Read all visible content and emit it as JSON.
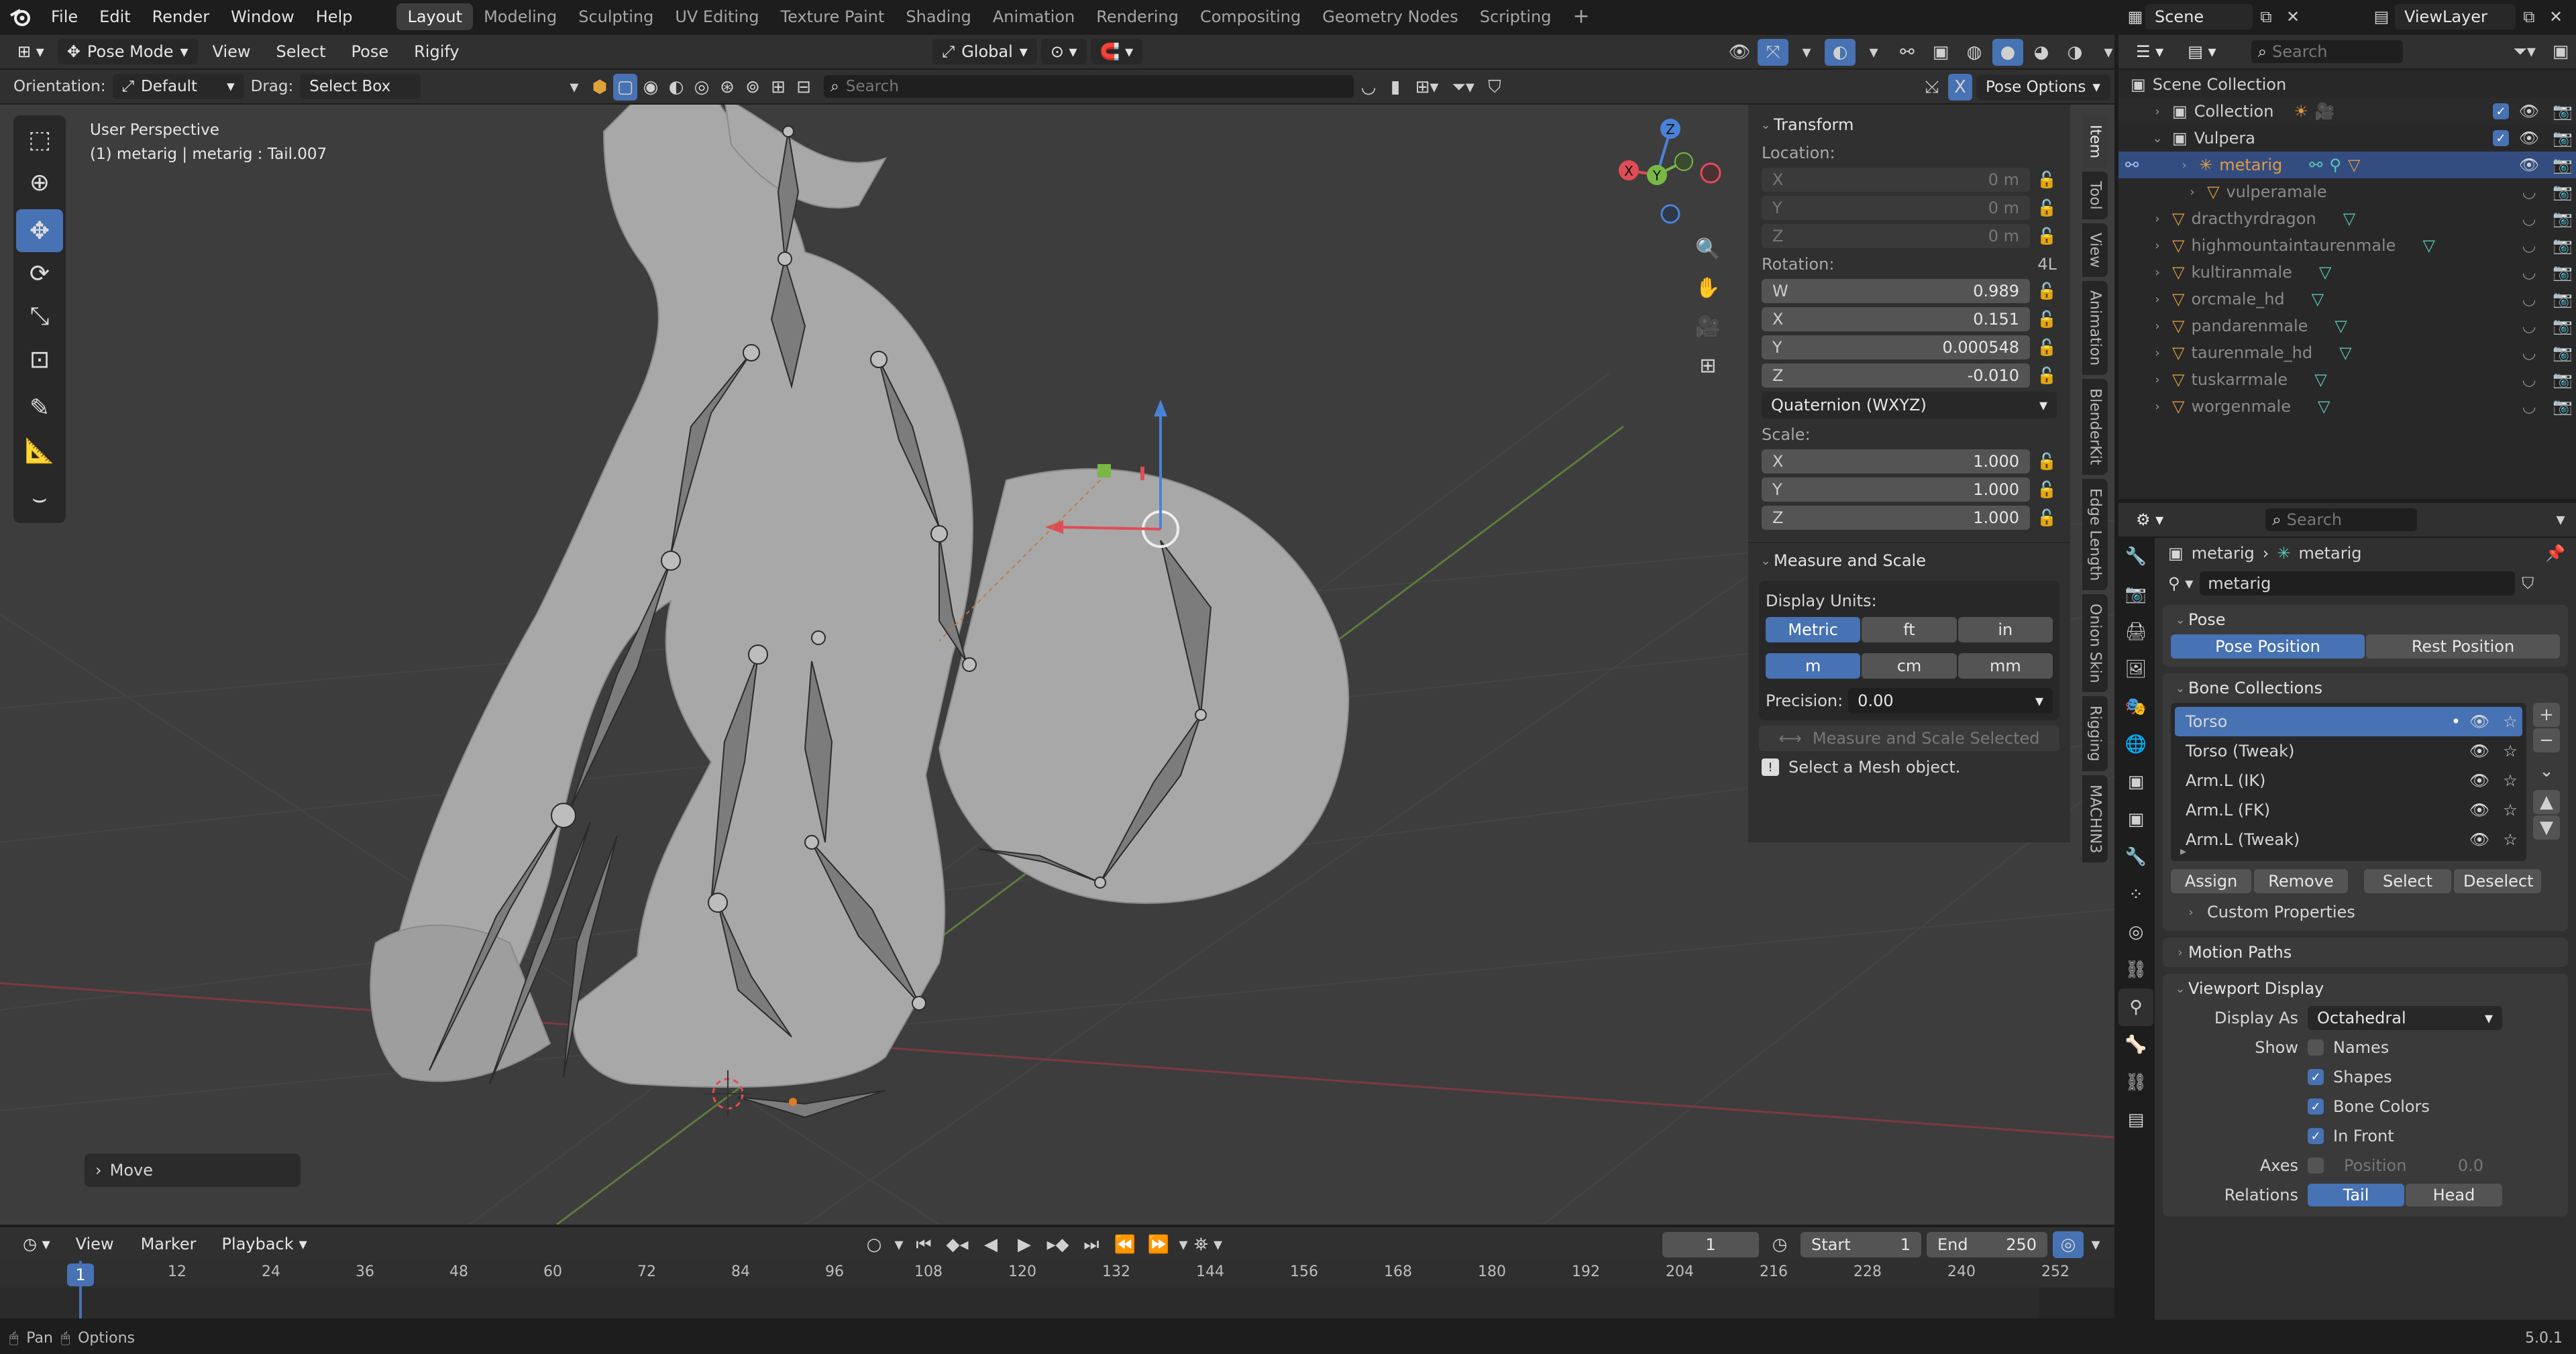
{
  "menu": {
    "file": "File",
    "edit": "Edit",
    "render": "Render",
    "window": "Window",
    "help": "Help"
  },
  "workspaces": [
    "Layout",
    "Modeling",
    "Sculpting",
    "UV Editing",
    "Texture Paint",
    "Shading",
    "Animation",
    "Rendering",
    "Compositing",
    "Geometry Nodes",
    "Scripting"
  ],
  "scene": "Scene",
  "view_layer": "ViewLayer",
  "viewport_header": {
    "mode": "Pose Mode",
    "view": "View",
    "select": "Select",
    "pose": "Pose",
    "rigify": "Rigify",
    "orientation_global": "Global"
  },
  "tool_settings": {
    "orientation_label": "Orientation:",
    "orientation_value": "Default",
    "drag_label": "Drag:",
    "drag_value": "Select Box",
    "search_placeholder": "Search",
    "pose_options": "Pose Options"
  },
  "viewport": {
    "perspective": "User Perspective",
    "active": "(1) metarig | metarig : Tail.007",
    "operator": "Move"
  },
  "gizmo": {
    "z": "Z",
    "y": "Y",
    "x": "X"
  },
  "npanel": {
    "transform_title": "Transform",
    "location_label": "Location:",
    "location": [
      {
        "axis": "X",
        "value": "0 m"
      },
      {
        "axis": "Y",
        "value": "0 m"
      },
      {
        "axis": "Z",
        "value": "0 m"
      }
    ],
    "rotation_label": "Rotation:",
    "rotation_mode_short": "4L",
    "rotation": [
      {
        "axis": "W",
        "value": "0.989"
      },
      {
        "axis": "X",
        "value": "0.151"
      },
      {
        "axis": "Y",
        "value": "0.000548"
      },
      {
        "axis": "Z",
        "value": "-0.010"
      }
    ],
    "rotation_mode": "Quaternion (WXYZ)",
    "scale_label": "Scale:",
    "scale": [
      {
        "axis": "X",
        "value": "1.000"
      },
      {
        "axis": "Y",
        "value": "1.000"
      },
      {
        "axis": "Z",
        "value": "1.000"
      }
    ],
    "measure_title": "Measure and Scale",
    "display_units_label": "Display Units:",
    "units_system": [
      "Metric",
      "ft",
      "in"
    ],
    "units_length": [
      "m",
      "cm",
      "mm"
    ],
    "precision_label": "Precision:",
    "precision_value": "0.00",
    "measure_button": "Measure and Scale Selected",
    "info": "Select a Mesh object.",
    "tabs": [
      "Item",
      "Tool",
      "View",
      "Animation",
      "BlenderKit",
      "Edge Length",
      "Onion Skin",
      "Rigging",
      "MACHIN3"
    ]
  },
  "outliner": {
    "search_placeholder": "Search",
    "scene_collection": "Scene Collection",
    "collection": "Collection",
    "vulpera": "Vulpera",
    "metarig": "metarig",
    "vulperamale": "vulperamale",
    "items": [
      "dracthyrdragon",
      "highmountaintaurenmale",
      "kultiranmale",
      "orcmale_hd",
      "pandarenmale",
      "taurenmale_hd",
      "tuskarrmale",
      "worgenmale"
    ]
  },
  "properties": {
    "search_placeholder": "Search",
    "breadcrumb_obj": "metarig",
    "breadcrumb_data": "metarig",
    "data_name": "metarig",
    "pose_title": "Pose",
    "pose_position": "Pose Position",
    "rest_position": "Rest Position",
    "bone_collections_title": "Bone Collections",
    "bone_collections": [
      "Torso",
      "Torso (Tweak)",
      "Arm.L (IK)",
      "Arm.L (FK)",
      "Arm.L (Tweak)"
    ],
    "assign": "Assign",
    "remove": "Remove",
    "select": "Select",
    "deselect": "Deselect",
    "custom_properties": "Custom Properties",
    "motion_paths": "Motion Paths",
    "viewport_display": "Viewport Display",
    "display_as_label": "Display As",
    "display_as": "Octahedral",
    "show_label": "Show",
    "names": "Names",
    "shapes": "Shapes",
    "bone_colors": "Bone Colors",
    "in_front": "In Front",
    "axes_label": "Axes",
    "position_label": "Position",
    "position_value": "0.0",
    "relations_label": "Relations",
    "tail": "Tail",
    "head": "Head"
  },
  "timeline": {
    "view": "View",
    "marker": "Marker",
    "playback": "Playback",
    "current_frame": "1",
    "start_label": "Start",
    "start": "1",
    "end_label": "End",
    "end": "250",
    "ruler": [
      "1",
      "12",
      "24",
      "36",
      "48",
      "60",
      "72",
      "84",
      "96",
      "108",
      "120",
      "132",
      "144",
      "156",
      "168",
      "180",
      "192",
      "204",
      "216",
      "228",
      "240",
      "252"
    ]
  },
  "statusbar": {
    "pan": "Pan",
    "options": "Options",
    "version": "5.0.1"
  },
  "colors": {
    "accent": "#4772b3",
    "x_axis": "#e04c55",
    "y_axis": "#78b844",
    "z_axis": "#4a82d8",
    "bg": "#3d3d3d"
  }
}
